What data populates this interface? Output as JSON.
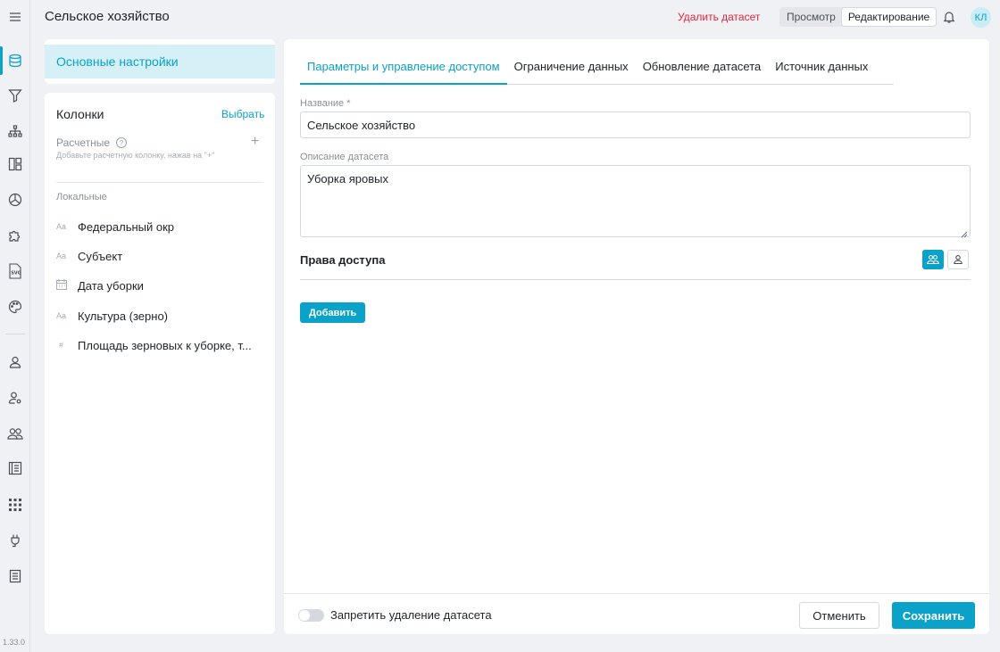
{
  "header": {
    "title": "Сельское хозяйство",
    "delete_label": "Удалить датасет",
    "mode_view": "Просмотр",
    "mode_edit": "Редактирование",
    "avatar_initials": "КЛ"
  },
  "rail": {
    "icons": [
      "menu-icon",
      "database-icon",
      "filter-icon",
      "hierarchy-icon",
      "layout-icon",
      "pie-chart-icon",
      "puzzle-icon",
      "svg-icon",
      "palette-icon",
      "user-icon",
      "user-settings-icon",
      "users-icon",
      "book-icon",
      "grid-icon",
      "plug-icon",
      "document-list-icon"
    ],
    "version": "1.33.0"
  },
  "sidebar": {
    "settings_label": "Основные настройки",
    "columns_title": "Колонки",
    "choose_label": "Выбрать",
    "calculated_label": "Расчетные",
    "calculated_hint": "Добавьте расчетную колонку, нажав на \"+\"",
    "local_label": "Локальные",
    "columns": [
      {
        "type": "Aa",
        "name": "Федеральный окр"
      },
      {
        "type": "Aa",
        "name": "Субъект"
      },
      {
        "type": "calendar",
        "name": "Дата уборки"
      },
      {
        "type": "Aa",
        "name": "Культура (зерно)"
      },
      {
        "type": "#",
        "name": "Площадь зерновых к уборке, т..."
      }
    ]
  },
  "main": {
    "tabs": [
      {
        "label": "Параметры и управление доступом",
        "active": true
      },
      {
        "label": "Ограничение данных",
        "active": false
      },
      {
        "label": "Обновление датасета",
        "active": false
      },
      {
        "label": "Источник данных",
        "active": false
      }
    ],
    "name_label": "Название *",
    "name_value": "Сельское хозяйство",
    "desc_label": "Описание датасета",
    "desc_value": "Уборка яровых",
    "rights_title": "Права доступа",
    "add_label": "Добавить",
    "footer": {
      "toggle_label": "Запретить удаление датасета",
      "toggle_on": false,
      "cancel_label": "Отменить",
      "save_label": "Сохранить"
    }
  },
  "colors": {
    "accent": "#0aa2c8",
    "danger": "#e0243b",
    "active_bg": "#d6f0f7"
  }
}
